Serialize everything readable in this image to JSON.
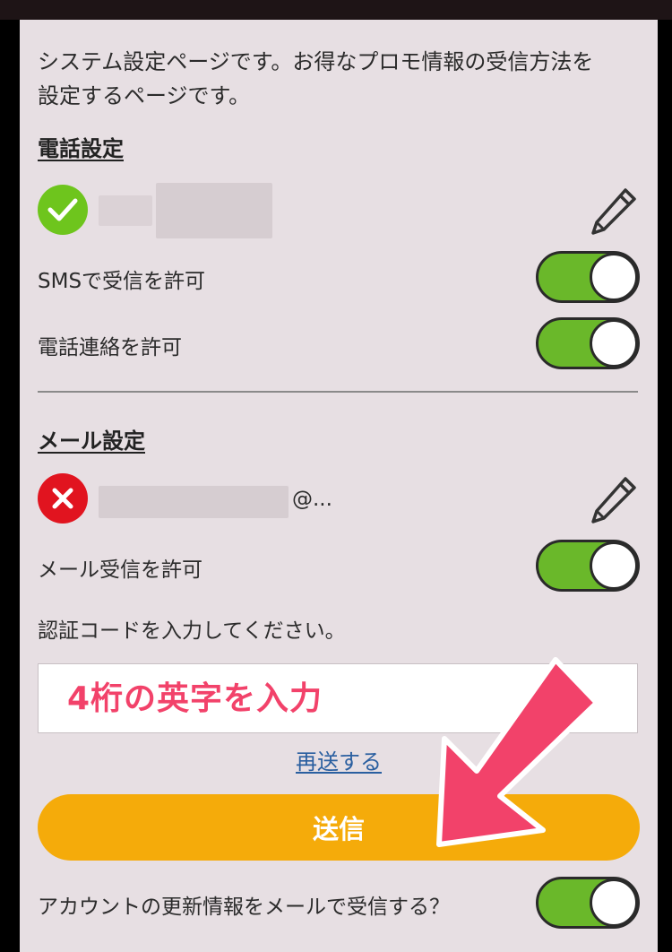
{
  "intro": {
    "line1": "システム設定ページです。お得なプロモ情報の受信方法を",
    "line2": "設定するページです。"
  },
  "phone_section": {
    "heading": "電話設定",
    "status": "verified",
    "sms_label": "SMSで受信を許可",
    "sms_on": true,
    "call_label": "電話連絡を許可",
    "call_on": true
  },
  "mail_section": {
    "heading": "メール設定",
    "status": "unverified",
    "email_suffix": "@...",
    "mail_label": "メール受信を許可",
    "mail_on": true,
    "code_prompt": "認証コードを入力してください。",
    "code_value": "4桁の英字を入力",
    "resend_label": "再送する",
    "submit_label": "送信",
    "account_update_label": "アカウントの更新情報をメールで受信する？",
    "account_update_on": true
  },
  "colors": {
    "toggle_on": "#6ab82a",
    "submit": "#f5ab0a",
    "annotation": "#f2426a",
    "verified": "#6ec51d",
    "error": "#e1141f"
  },
  "icons": [
    "check-icon",
    "cross-icon",
    "pencil-icon",
    "annotation-arrow"
  ]
}
